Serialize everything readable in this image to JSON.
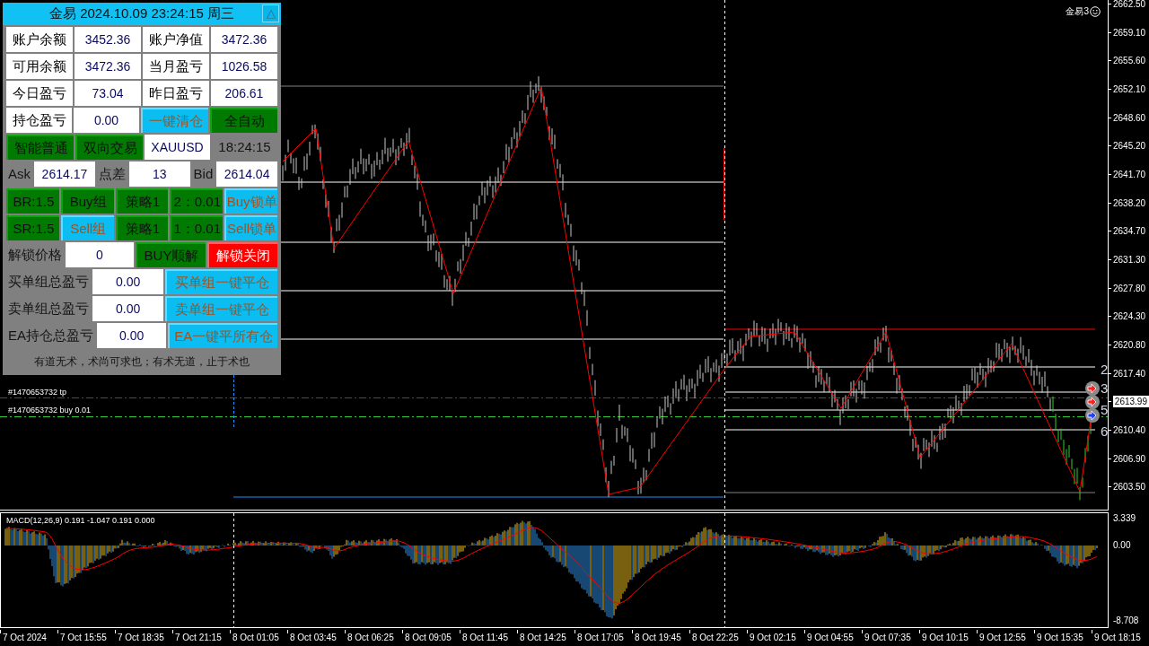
{
  "panel": {
    "title": "金易 2024.10.09 23:24:15 周三",
    "collapse_button": "△",
    "rows": [
      {
        "cells": [
          {
            "kind": "label",
            "text": "账户余额"
          },
          {
            "kind": "value",
            "text": "3452.36"
          },
          {
            "kind": "label",
            "text": "账户净值"
          },
          {
            "kind": "value",
            "text": "3472.36"
          }
        ]
      },
      {
        "cells": [
          {
            "kind": "label",
            "text": "可用余额"
          },
          {
            "kind": "value",
            "text": "3472.36"
          },
          {
            "kind": "label",
            "text": "当月盈亏"
          },
          {
            "kind": "value",
            "text": "1026.58"
          }
        ]
      },
      {
        "cells": [
          {
            "kind": "label",
            "text": "今日盈亏"
          },
          {
            "kind": "value",
            "text": "73.04"
          },
          {
            "kind": "label",
            "text": "昨日盈亏"
          },
          {
            "kind": "value",
            "text": "206.61"
          }
        ]
      },
      {
        "cells": [
          {
            "kind": "label",
            "text": "持仓盈亏"
          },
          {
            "kind": "value",
            "text": "0.00"
          },
          {
            "kind": "button",
            "text": "一键清仓",
            "color": "#00bfff"
          },
          {
            "kind": "button",
            "text": "全自动",
            "color": "#008000"
          }
        ]
      },
      {
        "cells": [
          {
            "kind": "button",
            "text": "智能普通",
            "color": "#008000"
          },
          {
            "kind": "button",
            "text": "双向交易",
            "color": "#008000"
          },
          {
            "kind": "value",
            "text": "XAUUSD"
          },
          {
            "kind": "caption",
            "text": "18:24:15"
          }
        ]
      },
      {
        "cells": [
          {
            "kind": "caption",
            "text": "Ask"
          },
          {
            "kind": "value",
            "text": "2614.17"
          },
          {
            "kind": "caption",
            "text": "点差"
          },
          {
            "kind": "value",
            "text": "13"
          },
          {
            "kind": "caption",
            "text": "Bid"
          },
          {
            "kind": "value",
            "text": "2614.04"
          }
        ]
      },
      {
        "cells": [
          {
            "kind": "button",
            "text": "BR:1.5",
            "color": "#008000"
          },
          {
            "kind": "button",
            "text": "Buy组",
            "color": "#008000"
          },
          {
            "kind": "button",
            "text": "策略1",
            "color": "#008000"
          },
          {
            "kind": "button",
            "text": "2：0.01",
            "color": "#008000"
          },
          {
            "kind": "button",
            "text": "Buy锁单",
            "color": "#00bfff"
          }
        ]
      },
      {
        "cells": [
          {
            "kind": "button",
            "text": "SR:1.5",
            "color": "#008000"
          },
          {
            "kind": "button",
            "text": "Sell组",
            "color": "#00bfff"
          },
          {
            "kind": "button",
            "text": "策略1",
            "color": "#008000"
          },
          {
            "kind": "button",
            "text": "1：0.01",
            "color": "#008000"
          },
          {
            "kind": "button",
            "text": "Sell锁单",
            "color": "#00bfff"
          }
        ]
      },
      {
        "cells": [
          {
            "kind": "caption",
            "text": "解锁价格"
          },
          {
            "kind": "value",
            "text": "0"
          },
          {
            "kind": "button",
            "text": "BUY顺解",
            "color": "#008000"
          },
          {
            "kind": "button",
            "text": "解锁关闭",
            "color": "#ff0000"
          }
        ]
      },
      {
        "cells": [
          {
            "kind": "caption",
            "text": "买单组总盈亏"
          },
          {
            "kind": "value",
            "text": "0.00"
          },
          {
            "kind": "button",
            "text": "买单组一键平仓",
            "color": "#00bfff"
          }
        ]
      },
      {
        "cells": [
          {
            "kind": "caption",
            "text": "卖单组总盈亏"
          },
          {
            "kind": "value",
            "text": "0.00"
          },
          {
            "kind": "button",
            "text": "卖单组一键平仓",
            "color": "#00bfff"
          }
        ]
      },
      {
        "cells": [
          {
            "kind": "caption",
            "text": "EA持仓总盈亏"
          },
          {
            "kind": "value",
            "text": "0.00"
          },
          {
            "kind": "button",
            "text": "EA一键平所有仓",
            "color": "#00bfff"
          }
        ]
      }
    ],
    "motto": "有道无术，术尚可求也；有术无道，止于术也"
  },
  "chart": {
    "ea_badge": "金易3",
    "order_labels": [
      "#1470653732 tp",
      "#1470653732 buy 0.01"
    ],
    "line_labels": [
      "2",
      "3",
      "5",
      "6"
    ],
    "price_axis": [
      {
        "label": "2662.50",
        "current": false
      },
      {
        "label": "2659.10",
        "current": false
      },
      {
        "label": "2655.60",
        "current": false
      },
      {
        "label": "2652.10",
        "current": false
      },
      {
        "label": "2648.60",
        "current": false
      },
      {
        "label": "2645.20",
        "current": false
      },
      {
        "label": "2641.70",
        "current": false
      },
      {
        "label": "2638.20",
        "current": false
      },
      {
        "label": "2634.70",
        "current": false
      },
      {
        "label": "2631.30",
        "current": false
      },
      {
        "label": "2627.80",
        "current": false
      },
      {
        "label": "2624.30",
        "current": false
      },
      {
        "label": "2620.80",
        "current": false
      },
      {
        "label": "2617.40",
        "current": false
      },
      {
        "label": "2613.99",
        "current": true
      },
      {
        "label": "2610.40",
        "current": false
      },
      {
        "label": "2606.90",
        "current": false
      },
      {
        "label": "2603.50",
        "current": false
      }
    ]
  },
  "macd": {
    "legend": "MACD(12,26,9) 0.191 -1.047 0.191 0.000",
    "axis": [
      "3.339",
      "0.00",
      "-8.708"
    ]
  },
  "time_axis": [
    "7 Oct 2024",
    "7 Oct 15:55",
    "7 Oct 18:35",
    "7 Oct 21:15",
    "8 Oct 01:05",
    "8 Oct 03:45",
    "8 Oct 06:25",
    "8 Oct 09:05",
    "8 Oct 11:45",
    "8 Oct 14:25",
    "8 Oct 17:05",
    "8 Oct 19:45",
    "8 Oct 22:25",
    "9 Oct 02:15",
    "9 Oct 04:55",
    "9 Oct 07:35",
    "9 Oct 10:15",
    "9 Oct 12:55",
    "9 Oct 15:35",
    "9 Oct 18:15"
  ]
}
